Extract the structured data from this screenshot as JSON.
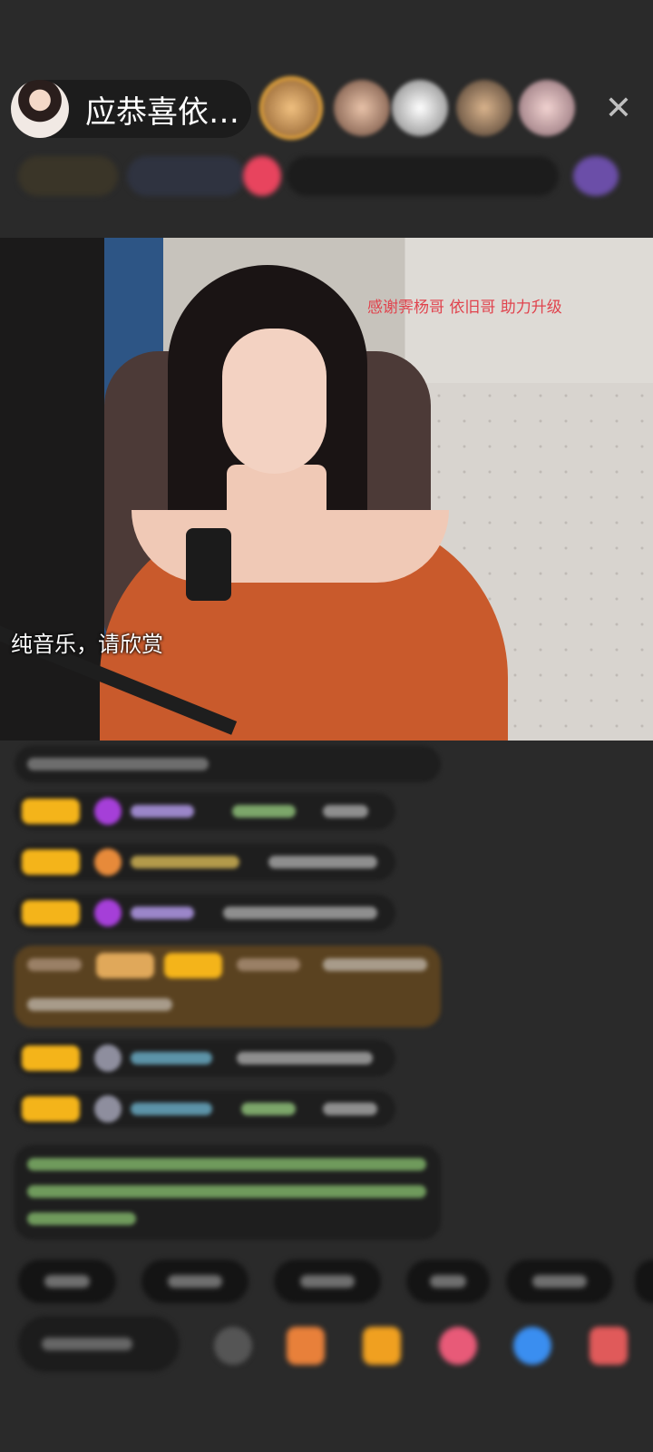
{
  "header": {
    "host_name": "应恭喜依…",
    "close_label": "✕"
  },
  "video": {
    "banner_text": "感谢霁杨哥 依旧哥 助力升级",
    "caption_text": "纯音乐，请欣赏"
  },
  "colors": {
    "background": "#2a2a2a",
    "badge_gold": "#f4b41a",
    "banner_red": "#e0434d"
  },
  "icons": {
    "close": "close-icon",
    "gift": "gift-icon",
    "share": "share-icon",
    "more": "more-icon"
  }
}
